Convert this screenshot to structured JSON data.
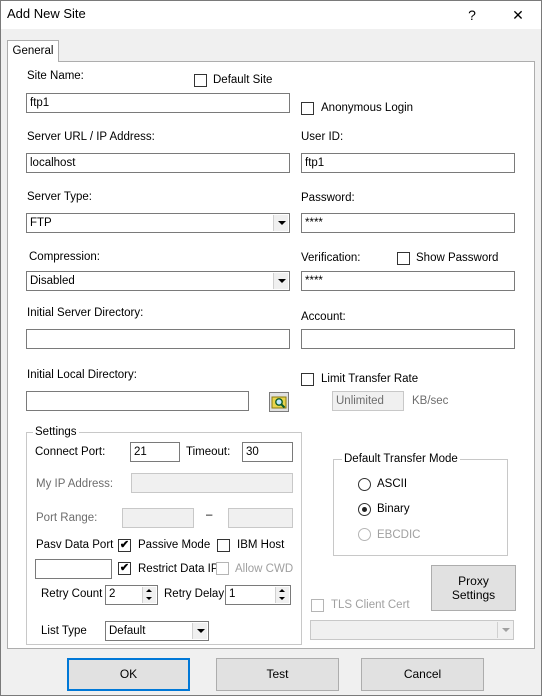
{
  "window": {
    "title": "Add New Site",
    "help_glyph": "?",
    "close_glyph": "✕"
  },
  "tab": {
    "label": "General"
  },
  "site_name": {
    "label": "Site Name:",
    "value": "ftp1"
  },
  "default_site": {
    "label": "Default Site",
    "checked": false
  },
  "anonymous_login": {
    "label": "Anonymous Login",
    "checked": false
  },
  "server_url": {
    "label": "Server URL / IP Address:",
    "value": "localhost"
  },
  "user_id": {
    "label": "User ID:",
    "value": "ftp1"
  },
  "server_type": {
    "label": "Server Type:",
    "value": "FTP"
  },
  "password": {
    "label": "Password:",
    "value": "****"
  },
  "compression": {
    "label": "Compression:",
    "value": "Disabled"
  },
  "verification": {
    "label": "Verification:",
    "value": "****"
  },
  "show_password": {
    "label": "Show Password",
    "checked": false
  },
  "initial_server_dir": {
    "label": "Initial Server Directory:",
    "value": ""
  },
  "account": {
    "label": "Account:",
    "value": ""
  },
  "initial_local_dir": {
    "label": "Initial Local Directory:",
    "value": ""
  },
  "limit_transfer_rate": {
    "label": "Limit Transfer Rate",
    "checked": false,
    "rate_value": "Unlimited",
    "unit": "KB/sec"
  },
  "settings": {
    "title": "Settings",
    "connect_port_label": "Connect Port:",
    "connect_port_value": "21",
    "timeout_label": "Timeout:",
    "timeout_value": "30",
    "my_ip_label": "My IP Address:",
    "my_ip_value": "",
    "port_range_label": "Port Range:",
    "port_range_dash": "–",
    "pasv_label": "Pasv Data Port",
    "passive_mode_label": "Passive Mode",
    "passive_mode_checked": true,
    "ibm_host_label": "IBM Host",
    "ibm_host_checked": false,
    "restrict_ip_label": "Restrict Data IP",
    "restrict_ip_checked": true,
    "allow_cwd_label": "Allow CWD",
    "allow_cwd_checked": false,
    "retry_count_label": "Retry Count",
    "retry_count_value": "2",
    "retry_delay_label": "Retry Delay",
    "retry_delay_value": "1",
    "list_type_label": "List Type",
    "list_type_value": "Default"
  },
  "transfer_mode": {
    "title": "Default Transfer Mode",
    "options": [
      "ASCII",
      "Binary",
      "EBCDIC"
    ],
    "selected": "Binary"
  },
  "proxy_button": {
    "line1": "Proxy",
    "line2": "Settings"
  },
  "tls": {
    "label": "TLS Client Cert",
    "checked": false
  },
  "buttons": {
    "ok": "OK",
    "test": "Test",
    "cancel": "Cancel"
  },
  "icons": {
    "browse_icon": "folder-search-icon",
    "checkmark": "✔"
  }
}
